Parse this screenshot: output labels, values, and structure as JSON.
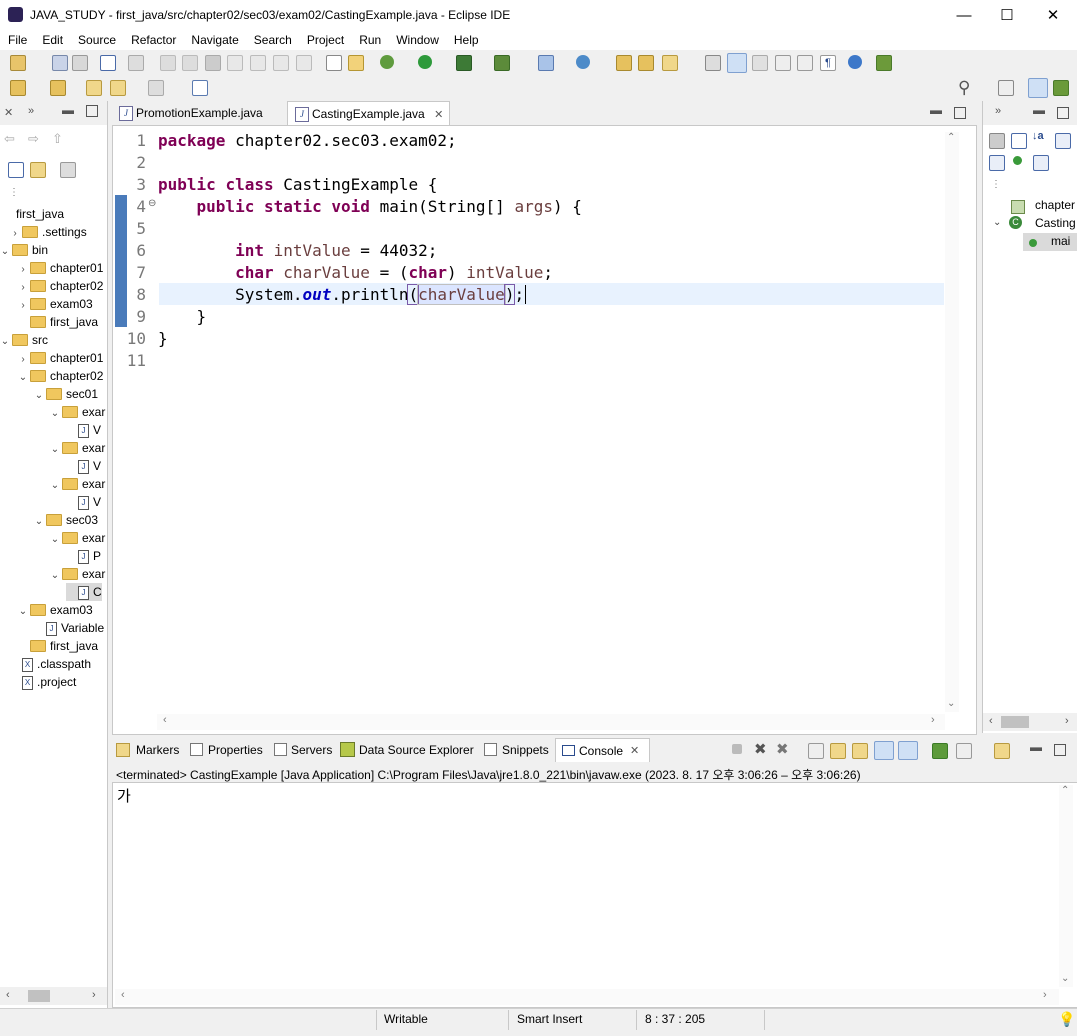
{
  "window": {
    "title": "JAVA_STUDY - first_java/src/chapter02/sec03/exam02/CastingExample.java - Eclipse IDE",
    "minimize": "—",
    "maximize": "☐",
    "close": "✕"
  },
  "menu": [
    "File",
    "Edit",
    "Source",
    "Refactor",
    "Navigate",
    "Search",
    "Project",
    "Run",
    "Window",
    "Help"
  ],
  "explorer": {
    "tree": [
      {
        "label": "first_java",
        "indent": 0,
        "type": "project"
      },
      {
        "label": ".settings",
        "indent": 1,
        "type": "folder",
        "arrow": ">"
      },
      {
        "label": "bin",
        "indent": 0,
        "type": "folder",
        "arrow": "v"
      },
      {
        "label": "chapter01",
        "indent": 2,
        "type": "folder",
        "arrow": ">"
      },
      {
        "label": "chapter02",
        "indent": 2,
        "type": "folder",
        "arrow": ">"
      },
      {
        "label": "exam03",
        "indent": 2,
        "type": "folder",
        "arrow": ">"
      },
      {
        "label": "first_java",
        "indent": 2,
        "type": "folder",
        "arrow": ""
      },
      {
        "label": "src",
        "indent": 0,
        "type": "folder",
        "arrow": "v"
      },
      {
        "label": "chapter01",
        "indent": 2,
        "type": "folder",
        "arrow": ">"
      },
      {
        "label": "chapter02",
        "indent": 2,
        "type": "folder",
        "arrow": "v"
      },
      {
        "label": "sec01",
        "indent": 3,
        "type": "folder",
        "arrow": "v"
      },
      {
        "label": "exar",
        "indent": 4,
        "type": "folder",
        "arrow": "v"
      },
      {
        "label": "V",
        "indent": 5,
        "type": "java"
      },
      {
        "label": "exar",
        "indent": 4,
        "type": "folder",
        "arrow": "v"
      },
      {
        "label": "V",
        "indent": 5,
        "type": "java"
      },
      {
        "label": "exar",
        "indent": 4,
        "type": "folder",
        "arrow": "v"
      },
      {
        "label": "V",
        "indent": 5,
        "type": "java"
      },
      {
        "label": "sec03",
        "indent": 3,
        "type": "folder",
        "arrow": "v"
      },
      {
        "label": "exar",
        "indent": 4,
        "type": "folder",
        "arrow": "v"
      },
      {
        "label": "P",
        "indent": 5,
        "type": "java"
      },
      {
        "label": "exar",
        "indent": 4,
        "type": "folder",
        "arrow": "v"
      },
      {
        "label": "C",
        "indent": 5,
        "type": "java",
        "selected": true
      },
      {
        "label": "exam03",
        "indent": 2,
        "type": "folder",
        "arrow": "v"
      },
      {
        "label": "Variable",
        "indent": 3,
        "type": "java"
      },
      {
        "label": "first_java",
        "indent": 2,
        "type": "folder",
        "arrow": ""
      },
      {
        "label": ".classpath",
        "indent": 1,
        "type": "xml"
      },
      {
        "label": ".project",
        "indent": 1,
        "type": "xml"
      }
    ]
  },
  "editor": {
    "tabs": [
      {
        "label": "PromotionExample.java",
        "active": false
      },
      {
        "label": "CastingExample.java",
        "active": true
      }
    ],
    "line_numbers": [
      "1",
      "2",
      "3",
      "4",
      "5",
      "6",
      "7",
      "8",
      "9",
      "10",
      "11"
    ]
  },
  "outline": {
    "items": [
      {
        "label": "chapter"
      },
      {
        "label": "Casting"
      },
      {
        "label": "mai"
      }
    ]
  },
  "bottom": {
    "tabs": [
      "Markers",
      "Properties",
      "Servers",
      "Data Source Explorer",
      "Snippets",
      "Console"
    ],
    "console_header": "<terminated> CastingExample [Java Application] C:\\Program Files\\Java\\jre1.8.0_221\\bin\\javaw.exe  (2023. 8. 17 오후 3:06:26 – 오후 3:06:26)",
    "console_output": "가"
  },
  "status": {
    "writable": "Writable",
    "insert_mode": "Smart Insert",
    "position": "8 : 37 : 205"
  }
}
